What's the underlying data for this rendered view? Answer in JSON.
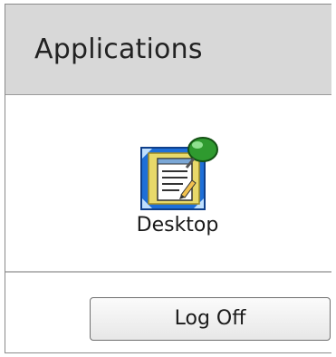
{
  "panel": {
    "title": "Applications",
    "applications": [
      {
        "label": "Desktop",
        "icon": "desktop-notepad-pin-icon"
      }
    ],
    "logoff_label": "Log Off"
  },
  "colors": {
    "header_bg": "#d8d8d8",
    "border": "#8a8a8a",
    "separator": "#b8b8b8",
    "pin_green": "#2f9a2f",
    "icon_blue": "#1e6fd8",
    "icon_paper": "#f0e6a8"
  }
}
